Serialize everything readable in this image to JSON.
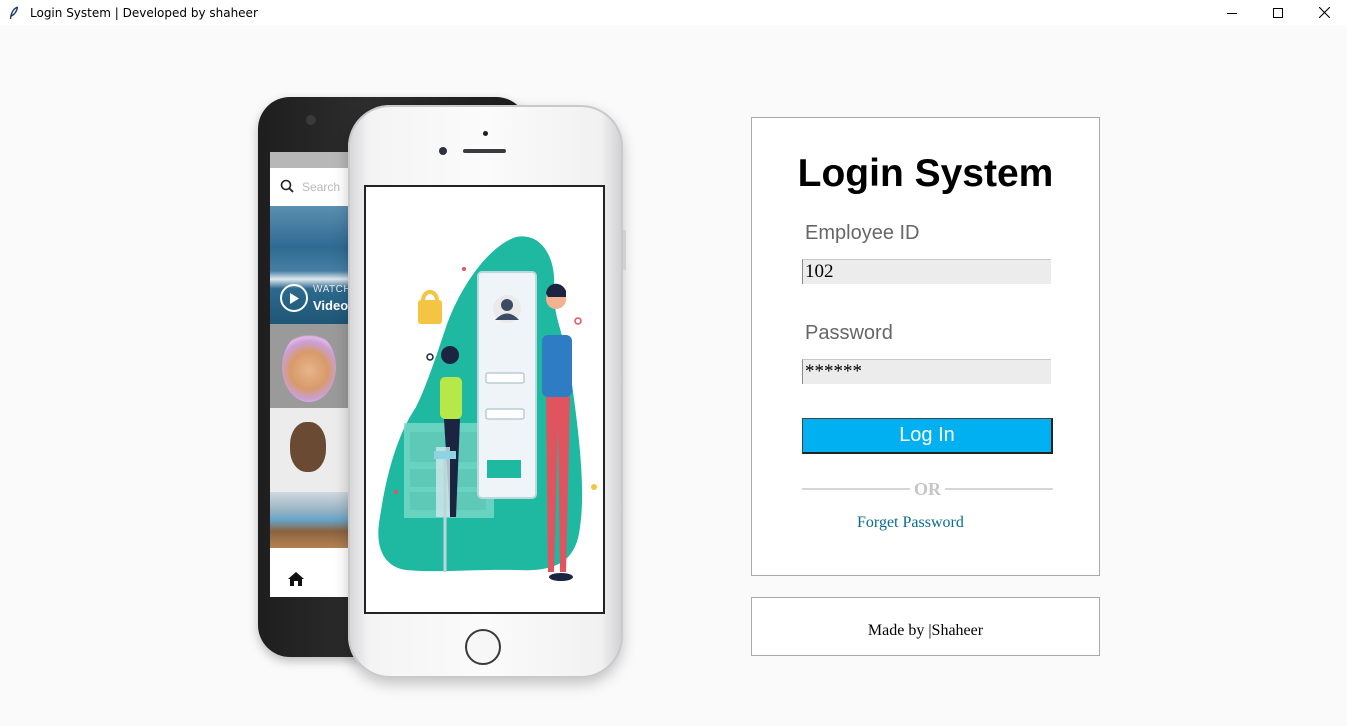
{
  "window": {
    "title": "Login System | Developed by shaheer",
    "app_icon": "feather-icon",
    "controls": [
      "minimize-icon",
      "maximize-icon",
      "close-icon"
    ]
  },
  "illustration": {
    "back_phone": {
      "search_placeholder": "Search",
      "watch_label": "WATCH",
      "video_label": "Video"
    }
  },
  "login": {
    "title": "Login System",
    "employee_id_label": "Employee ID",
    "employee_id_value": "102",
    "password_label": "Password",
    "password_value": "******",
    "login_button": "Log In",
    "or_text": "OR",
    "forget_password": "Forget Password"
  },
  "footer": {
    "made_by": "Made by |Shaheer"
  },
  "colors": {
    "background": "#fafafa",
    "login_button": "#00b0f0",
    "link": "#0a6b8e",
    "illustration_teal": "#1fb8a0"
  }
}
